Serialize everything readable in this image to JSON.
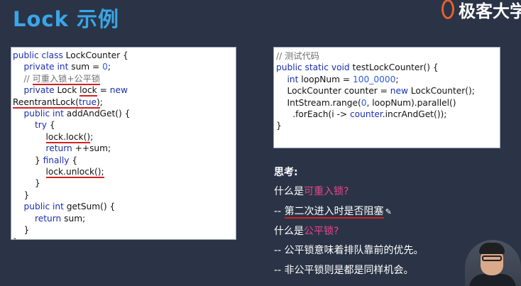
{
  "header": {
    "title": "Lock 示例",
    "logo_text": "极客大学"
  },
  "left_code": [
    {
      "text": "public class LockCounter {"
    },
    {
      "text": "    private int sum = 0;"
    },
    {
      "text": "    // 可重入锁+公平锁"
    },
    {
      "text": "    private Lock lock = new"
    },
    {
      "text": "ReentrantLock(true);"
    },
    {
      "text": "    public int addAndGet() {"
    },
    {
      "text": "        try {"
    },
    {
      "text": "            lock.lock();"
    },
    {
      "text": "            return ++sum;"
    },
    {
      "text": "        } finally {"
    },
    {
      "text": "            lock.unlock();"
    },
    {
      "text": "        }"
    },
    {
      "text": "    }"
    },
    {
      "text": "    public int getSum() {"
    },
    {
      "text": "        return sum;"
    },
    {
      "text": "    }"
    },
    {
      "text": "}"
    }
  ],
  "right_code": [
    {
      "text": "// 测试代码"
    },
    {
      "text": "public static void testLockCounter() {"
    },
    {
      "text": "    int loopNum = 100_0000;"
    },
    {
      "text": "    LockCounter counter = new LockCounter();"
    },
    {
      "text": "    IntStream.range(0, loopNum).parallel()"
    },
    {
      "text": "      .forEach(i -> counter.incrAndGet());"
    },
    {
      "text": "}"
    }
  ],
  "think": {
    "heading": "思考:",
    "q1_prefix": "什么是",
    "q1_term": "可重入锁?",
    "q1_answer_prefix": "-- ",
    "q1_answer": "第二次进入时是否阻塞",
    "q2_prefix": "什么是",
    "q2_term": "公平锁?",
    "q2_answer1": "-- 公平锁意味着排队靠前的优先。",
    "q2_answer2": "-- 非公平锁则是都是同样机会。"
  },
  "colors": {
    "background": "#2a3446",
    "title": "#3aa6e8",
    "highlight": "#e8468c",
    "underline": "#d42020"
  },
  "icons": {
    "logo": "geek-logo-icon",
    "pen": "pen-icon"
  }
}
